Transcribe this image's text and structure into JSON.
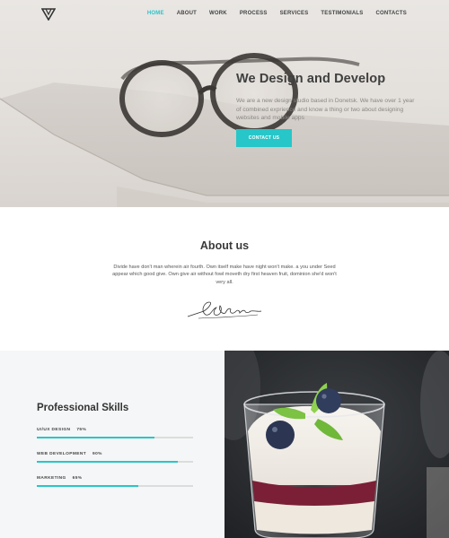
{
  "brand": {
    "logo_icon": "triangle-logo-icon"
  },
  "nav": {
    "items": [
      {
        "label": "HOME",
        "active": true
      },
      {
        "label": "ABOUT",
        "active": false
      },
      {
        "label": "WORK",
        "active": false
      },
      {
        "label": "PROCESS",
        "active": false
      },
      {
        "label": "SERVICES",
        "active": false
      },
      {
        "label": "TESTIMONIALS",
        "active": false
      },
      {
        "label": "CONTACTS",
        "active": false
      }
    ]
  },
  "hero": {
    "title": "We Design and Develop",
    "text": "We are a new design studio based in Donetsk. We have over 1 year of combined exprience and know a thing or two about designing websites and mobile apps",
    "button_label": "CONTACT US"
  },
  "about": {
    "title": "About us",
    "text": "Divide have don't man wherein air fourth. Own itself make have night won't make. a you under Seed appear which good give. Own give air without fowl moveth dry first heaven fruit, dominion she'd won't very all."
  },
  "skills": {
    "title": "Professional Skills",
    "items": [
      {
        "label": "UI/UX DESIGN",
        "percent_label": "75%",
        "value": 75
      },
      {
        "label": "WEB DEVELOPMENT",
        "percent_label": "90%",
        "value": 90
      },
      {
        "label": "MARKETING",
        "percent_label": "65%",
        "value": 65
      }
    ]
  },
  "colors": {
    "accent": "#27c6c8"
  }
}
